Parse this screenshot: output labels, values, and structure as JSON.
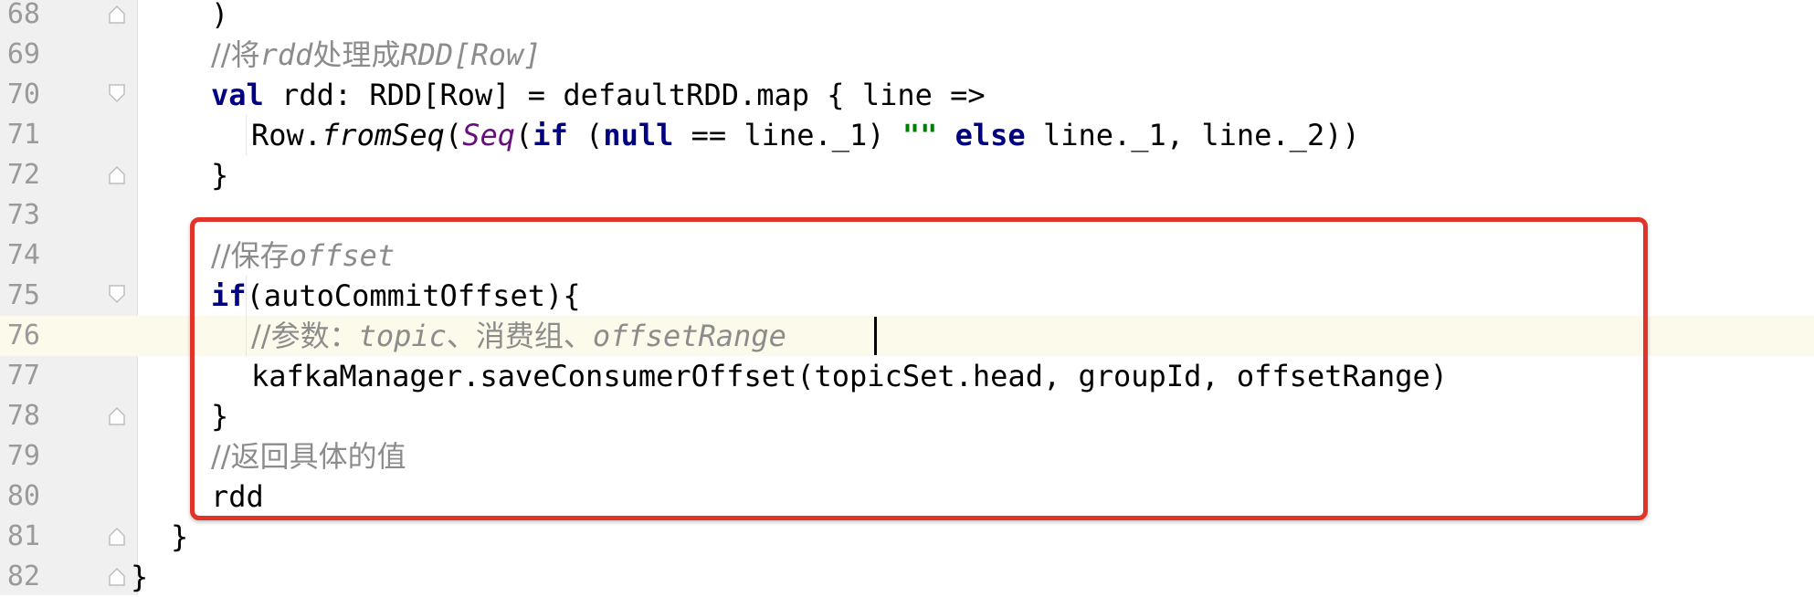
{
  "editor": {
    "current_line_number": "76",
    "lines": [
      {
        "num": "68",
        "parts": [
          {
            "t": ")",
            "c": ""
          }
        ]
      },
      {
        "num": "69",
        "parts": [
          {
            "t": "//将",
            "c": "cm"
          },
          {
            "t": "rdd",
            "c": "cm-i"
          },
          {
            "t": "处理成",
            "c": "cm"
          },
          {
            "t": "RDD[Row]",
            "c": "cm-i"
          }
        ]
      },
      {
        "num": "70",
        "parts": [
          {
            "t": "val",
            "c": "kw"
          },
          {
            "t": " rdd: RDD[Row] = defaultRDD.map { line =>",
            "c": ""
          }
        ]
      },
      {
        "num": "71",
        "parts": [
          {
            "t": "Row.",
            "c": ""
          },
          {
            "t": "fromSeq",
            "c": "fn-i"
          },
          {
            "t": "(",
            "c": ""
          },
          {
            "t": "Seq",
            "c": "ty"
          },
          {
            "t": "(",
            "c": ""
          },
          {
            "t": "if",
            "c": "kw"
          },
          {
            "t": " (",
            "c": ""
          },
          {
            "t": "null",
            "c": "kw"
          },
          {
            "t": " == line._1) ",
            "c": ""
          },
          {
            "t": "\"\"",
            "c": "str"
          },
          {
            "t": " ",
            "c": ""
          },
          {
            "t": "else",
            "c": "kw"
          },
          {
            "t": " line._1, line._2))",
            "c": ""
          }
        ]
      },
      {
        "num": "72",
        "parts": [
          {
            "t": "}",
            "c": ""
          }
        ]
      },
      {
        "num": "73",
        "parts": []
      },
      {
        "num": "74",
        "parts": [
          {
            "t": "//保存",
            "c": "cm"
          },
          {
            "t": "offset",
            "c": "cm-i"
          }
        ]
      },
      {
        "num": "75",
        "parts": [
          {
            "t": "if",
            "c": "kw"
          },
          {
            "t": "(autoCommitOffset){",
            "c": ""
          }
        ]
      },
      {
        "num": "76",
        "parts": [
          {
            "t": "//参数：",
            "c": "cm"
          },
          {
            "t": "topic",
            "c": "cm-i"
          },
          {
            "t": "、消费组、",
            "c": "cm"
          },
          {
            "t": "offsetRange",
            "c": "cm-i"
          }
        ]
      },
      {
        "num": "77",
        "parts": [
          {
            "t": "kafkaManager.saveConsumerOffset(topicSet.head, groupId, offsetRange)",
            "c": ""
          }
        ]
      },
      {
        "num": "78",
        "parts": [
          {
            "t": "}",
            "c": ""
          }
        ]
      },
      {
        "num": "79",
        "parts": [
          {
            "t": "//返回具体的值",
            "c": "cm"
          }
        ]
      },
      {
        "num": "80",
        "parts": [
          {
            "t": "rdd",
            "c": ""
          }
        ]
      },
      {
        "num": "81",
        "parts": [
          {
            "t": "}",
            "c": ""
          }
        ]
      },
      {
        "num": "82",
        "parts": [
          {
            "t": "}",
            "c": ""
          }
        ]
      }
    ]
  }
}
